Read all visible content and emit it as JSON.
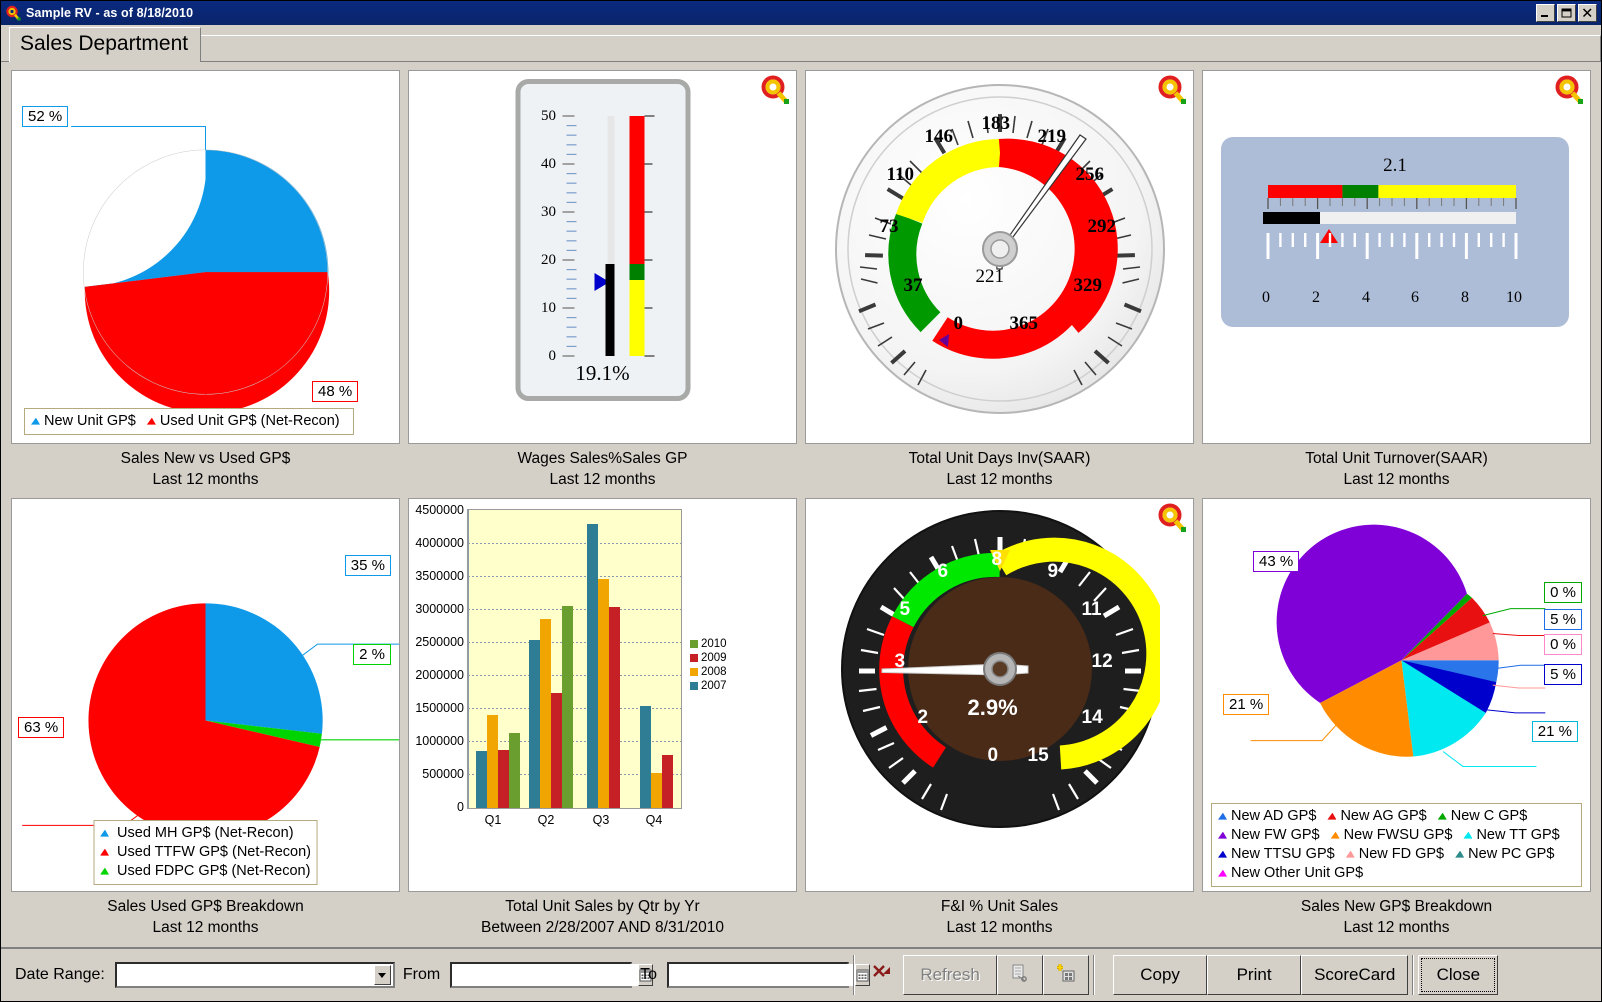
{
  "window": {
    "title": "Sample RV - as of 8/18/2010",
    "icon": "magnifier-icon",
    "minimize": "_",
    "maximize": "□",
    "close": "×"
  },
  "tabs": [
    {
      "label": "Sales Department",
      "active": true
    }
  ],
  "panels": [
    {
      "id": "sales-new-vs-used",
      "caption_line1": "Sales New vs Used GP$",
      "caption_line2": "Last 12 months",
      "drilldown_icon": "magnifier-icon",
      "has_drilldown": false
    },
    {
      "id": "wages-sales-pct",
      "caption_line1": "Wages Sales%Sales GP",
      "caption_line2": "Last 12 months",
      "drilldown_icon": "magnifier-icon",
      "has_drilldown": true
    },
    {
      "id": "total-unit-days-inv",
      "caption_line1": "Total Unit Days Inv(SAAR)",
      "caption_line2": "Last 12 months",
      "drilldown_icon": "magnifier-icon",
      "has_drilldown": true
    },
    {
      "id": "total-unit-turnover",
      "caption_line1": "Total Unit Turnover(SAAR)",
      "caption_line2": "Last 12 months",
      "drilldown_icon": "magnifier-icon",
      "has_drilldown": true
    },
    {
      "id": "sales-used-gp-breakdown",
      "caption_line1": "Sales Used GP$ Breakdown",
      "caption_line2": "Last 12 months",
      "drilldown_icon": "magnifier-icon",
      "has_drilldown": false
    },
    {
      "id": "total-unit-sales-by-qtr",
      "caption_line1": "Total Unit Sales by Qtr by Yr",
      "caption_line2": "Between 2/28/2007 AND 8/31/2010",
      "drilldown_icon": "magnifier-icon",
      "has_drilldown": false
    },
    {
      "id": "fi-pct-unit-sales",
      "caption_line1": "F&I % Unit Sales",
      "caption_line2": "Last 12 months",
      "drilldown_icon": "magnifier-icon",
      "has_drilldown": true
    },
    {
      "id": "sales-new-gp-breakdown",
      "caption_line1": "Sales New GP$ Breakdown",
      "caption_line2": "Last 12 months",
      "drilldown_icon": "magnifier-icon",
      "has_drilldown": false
    }
  ],
  "chart_data": [
    {
      "type": "pie",
      "id": "sales-new-vs-used",
      "title": "Sales New vs Used GP$",
      "subtitle": "Last 12 months",
      "labels": [
        "New Unit GP$",
        "Used Unit GP$ (Net-Recon)"
      ],
      "values": [
        52,
        48
      ],
      "value_labels": [
        "52 %",
        "48 %"
      ],
      "colors": [
        "#0e9ae8",
        "#fe0000"
      ],
      "legend_position": "bottom"
    },
    {
      "type": "gauge-linear-vertical",
      "id": "wages-sales-pct",
      "title": "Wages Sales%Sales GP",
      "subtitle": "Last 12 months",
      "value": 19.1,
      "value_label": "19.1%",
      "min": 0,
      "max": 50,
      "ticks": [
        0,
        10,
        20,
        30,
        40,
        50
      ],
      "bands": [
        {
          "from": 0,
          "to": 16,
          "color": "#ffff00"
        },
        {
          "from": 16,
          "to": 19,
          "color": "#008000"
        },
        {
          "from": 19,
          "to": 50,
          "color": "#ff0000"
        }
      ],
      "marker_value": 17.5,
      "marker_color": "#0000cc",
      "bar_color": "#000000"
    },
    {
      "type": "gauge-radial",
      "id": "total-unit-days-inv",
      "title": "Total Unit Days Inv(SAAR)",
      "subtitle": "Last 12 months",
      "value": 221,
      "value_label": "221",
      "min": 0,
      "max": 365,
      "tick_labels": [
        "0",
        "37",
        "73",
        "110",
        "146",
        "183",
        "219",
        "256",
        "292",
        "329",
        "365"
      ],
      "bands": [
        {
          "from": 0,
          "to": 110,
          "color": "#009900"
        },
        {
          "from": 110,
          "to": 183,
          "color": "#ffff00"
        },
        {
          "from": 183,
          "to": 365,
          "color": "#ff0000"
        }
      ],
      "marker_value": 0,
      "marker_color": "#660099",
      "theme": "light"
    },
    {
      "type": "gauge-linear-horizontal",
      "id": "total-unit-turnover",
      "title": "Total Unit Turnover(SAAR)",
      "subtitle": "Last 12 months",
      "value": 2.1,
      "value_label": "2.1",
      "min": 0,
      "max": 10,
      "ticks": [
        0,
        2,
        4,
        6,
        8,
        10
      ],
      "bands": [
        {
          "from": 0,
          "to": 3.0,
          "color": "#ff0000"
        },
        {
          "from": 3.0,
          "to": 4.45,
          "color": "#008000"
        },
        {
          "from": 4.45,
          "to": 10,
          "color": "#ffff00"
        }
      ],
      "marker_value": 2.5,
      "marker_color": "#ff0000",
      "bar_color": "#000000",
      "background": "#aebdd7"
    },
    {
      "type": "pie",
      "id": "sales-used-gp-breakdown",
      "title": "Sales Used GP$ Breakdown",
      "subtitle": "Last 12 months",
      "labels": [
        "Used MH GP$ (Net-Recon)",
        "Used TTFW GP$ (Net-Recon)",
        "Used FDPC GP$ (Net-Recon)"
      ],
      "values": [
        35,
        63,
        2
      ],
      "value_labels": [
        "35 %",
        "63 %",
        "2 %"
      ],
      "colors": [
        "#0e9ae8",
        "#fe0000",
        "#00d400"
      ],
      "legend_position": "bottom"
    },
    {
      "type": "bar",
      "id": "total-unit-sales-by-qtr",
      "title": "Total Unit Sales by Qtr by Yr",
      "subtitle": "Between 2/28/2007 AND 8/31/2010",
      "categories": [
        "Q1",
        "Q2",
        "Q3",
        "Q4"
      ],
      "series": [
        {
          "name": "2007",
          "color": "#2f7d95",
          "values": [
            848000,
            2515000,
            4262000,
            1530000
          ]
        },
        {
          "name": "2008",
          "color": "#f0a500",
          "values": [
            1390000,
            2828000,
            3424000,
            525000
          ]
        },
        {
          "name": "2009",
          "color": "#c52026",
          "values": [
            868000,
            1716000,
            3005000,
            795000
          ]
        },
        {
          "name": "2010",
          "color": "#6a9e2f",
          "values": [
            1123000,
            3030000,
            null,
            null
          ]
        }
      ],
      "series_draw_order": [
        "2007",
        "2008",
        "2009",
        "2010"
      ],
      "legend_order": [
        "2010",
        "2009",
        "2008",
        "2007"
      ],
      "ylim": [
        0,
        4500000
      ],
      "yticks": [
        0,
        500000,
        1000000,
        1500000,
        2000000,
        2500000,
        3000000,
        3500000,
        4000000,
        4500000
      ],
      "ytick_labels": [
        "0",
        "500000",
        "1000000",
        "1500000",
        "2000000",
        "2500000",
        "3000000",
        "3500000",
        "4000000",
        "4500000"
      ],
      "xlabel": "",
      "ylabel": "",
      "grid": true,
      "plot_background": "#ffffcc",
      "legend_position": "right"
    },
    {
      "type": "gauge-radial",
      "id": "fi-pct-unit-sales",
      "title": "F&I % Unit Sales",
      "subtitle": "Last 12 months",
      "value": 2.9,
      "value_label": "2.9%",
      "min": 0,
      "max": 15,
      "tick_labels": [
        "0",
        "2",
        "3",
        "5",
        "6",
        "8",
        "9",
        "11",
        "12",
        "14",
        "15"
      ],
      "bands": [
        {
          "from": 0,
          "to": 3.0,
          "color": "#ff0000"
        },
        {
          "from": 3.0,
          "to": 6.0,
          "color": "#00e800"
        },
        {
          "from": 6.0,
          "to": 15,
          "color": "#ffff00"
        }
      ],
      "marker_value": 8,
      "marker_color": "#ffe000",
      "theme": "dark"
    },
    {
      "type": "pie",
      "id": "sales-new-gp-breakdown",
      "title": "Sales New GP$ Breakdown",
      "subtitle": "Last 12 months",
      "labels": [
        "New AD GP$",
        "New AG GP$",
        "New C GP$",
        "New FW GP$",
        "New FWSU GP$",
        "New TT GP$",
        "New TTSU GP$",
        "New FD GP$",
        "New PC GP$",
        "New Other Unit GP$"
      ],
      "values": [
        5,
        2,
        0,
        43,
        21,
        21,
        5,
        2,
        0,
        0
      ],
      "value_labels": [
        "43 %",
        "0 %",
        "5 %",
        "0 %",
        "5 %",
        "21 %",
        "21 %"
      ],
      "colors": [
        "#1e6ee8",
        "#e81010",
        "#00a800",
        "#8000d8",
        "#ff8c00",
        "#00e8f0",
        "#0000cc",
        "#ff9999",
        "#2e8b8b",
        "#ff00ff"
      ],
      "legend_position": "bottom"
    }
  ],
  "toolbar": {
    "date_range_label": "Date Range:",
    "date_range_value": "",
    "date_range_placeholder": "",
    "from_label": "From",
    "from_value": "",
    "to_label": "To",
    "to_value": "",
    "clear_icon": "clear-filter-icon",
    "refresh_label": "Refresh",
    "refresh_enabled": false,
    "export_icon": "export-icon",
    "add_icon": "add-item-icon",
    "copy_label": "Copy",
    "print_label": "Print",
    "scorecard_label": "ScoreCard",
    "close_label": "Close"
  }
}
